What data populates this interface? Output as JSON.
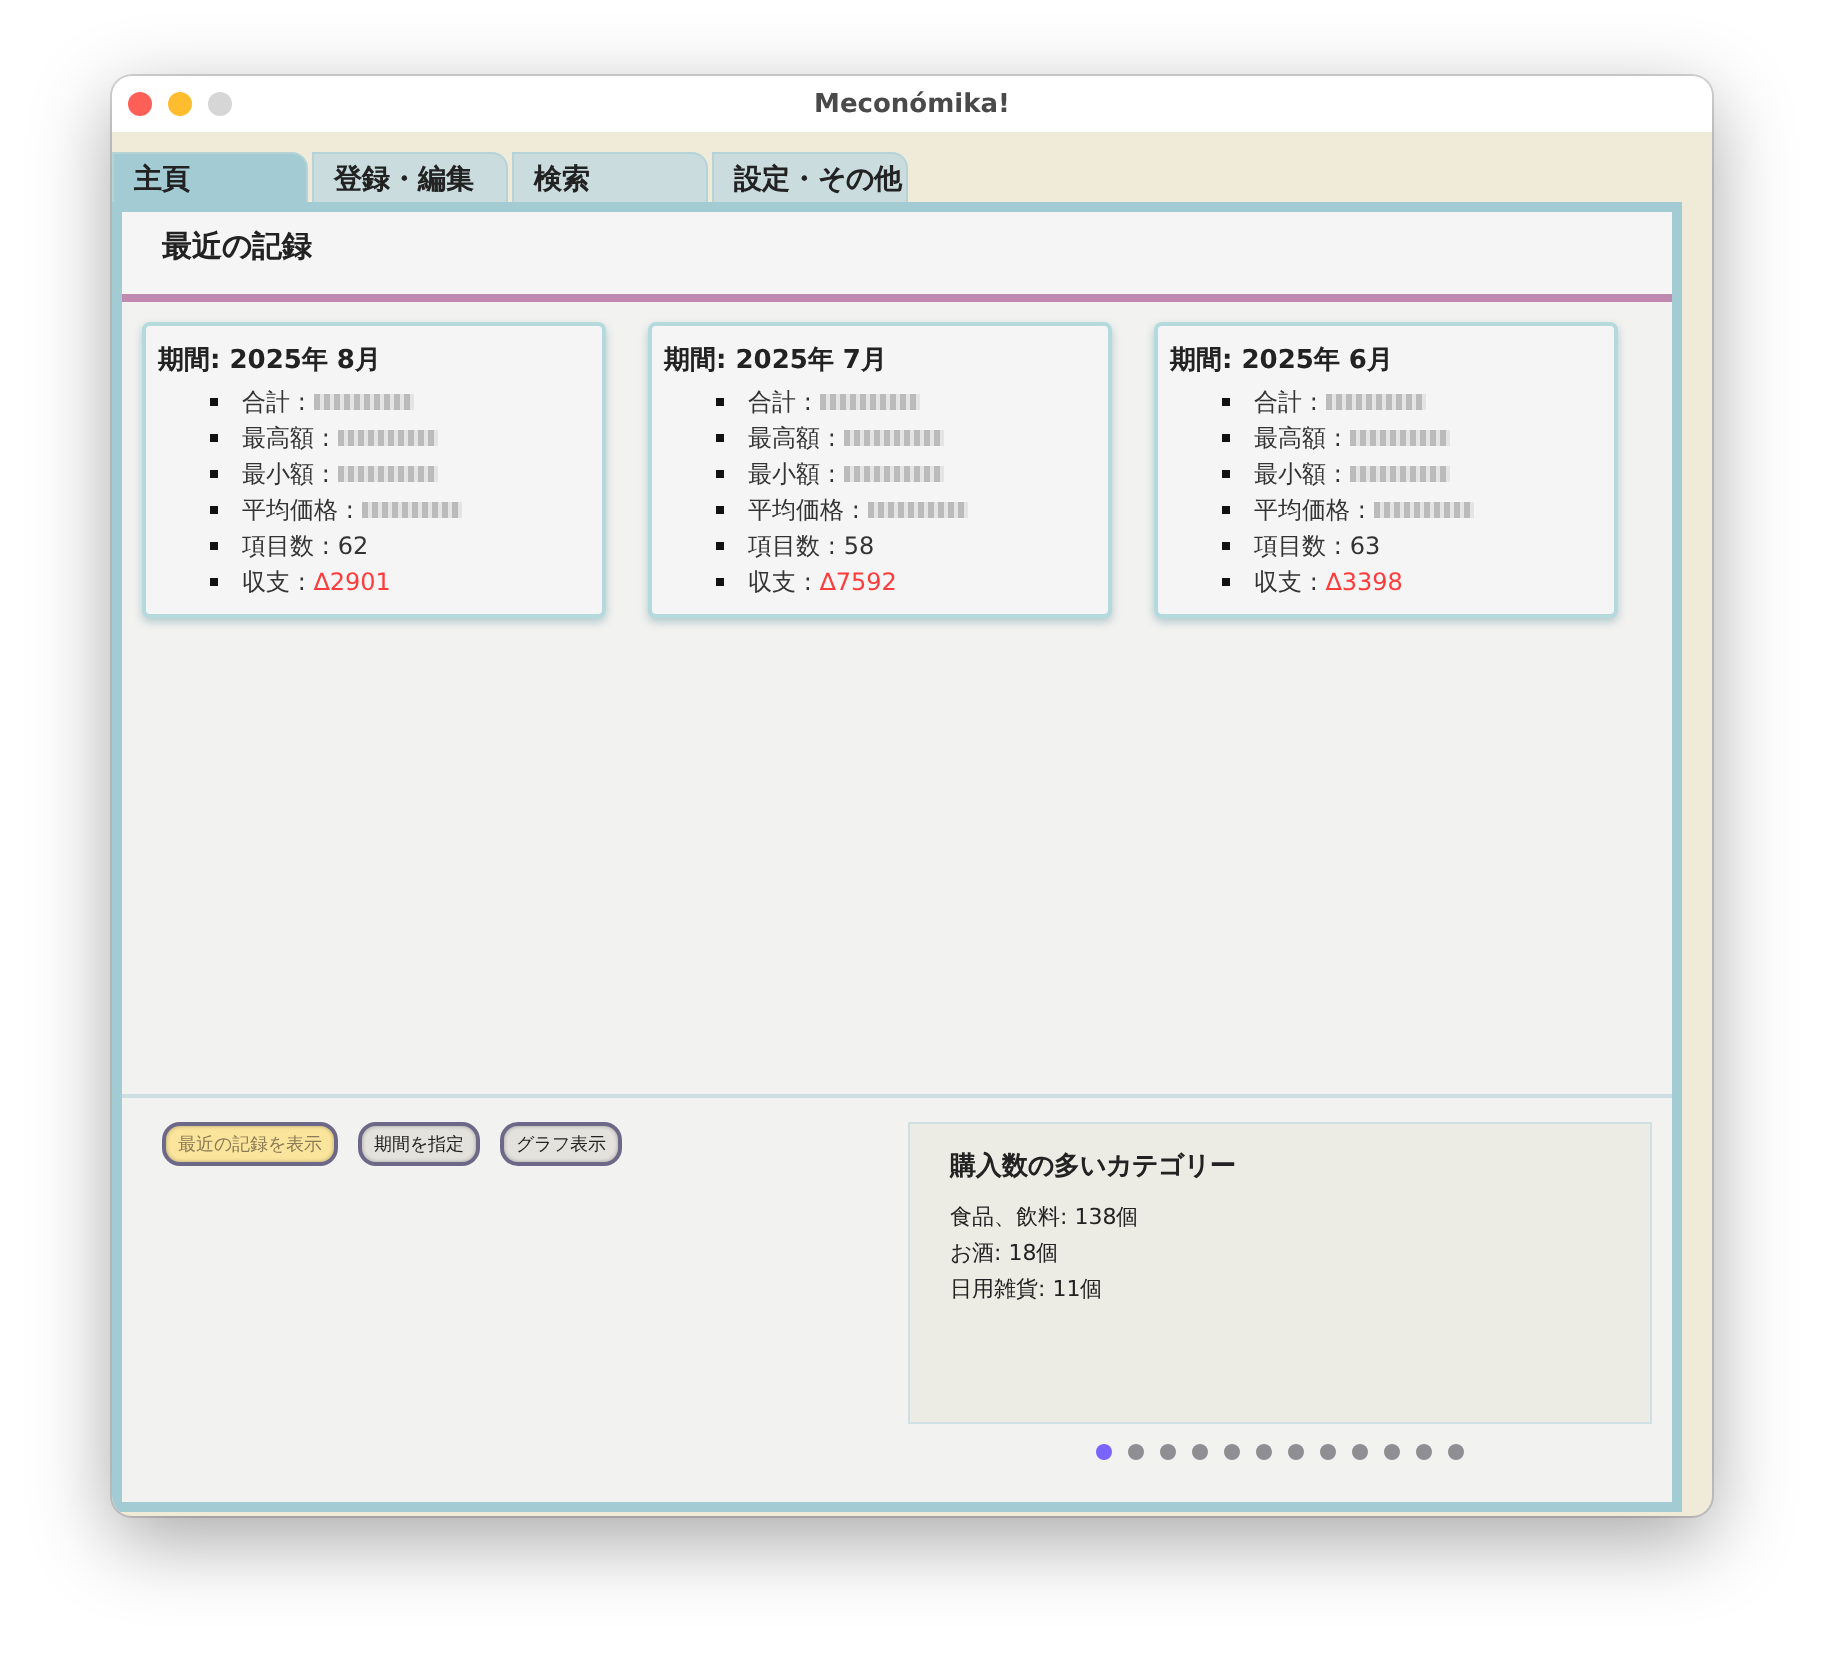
{
  "window": {
    "title": "Meconómika!"
  },
  "tabs": [
    {
      "label": "主頁",
      "selected": true
    },
    {
      "label": "登録・編集",
      "selected": false
    },
    {
      "label": "検索",
      "selected": false
    },
    {
      "label": "設定・その他",
      "selected": false
    }
  ],
  "section_title": "最近の記録",
  "cards": [
    {
      "title": "期間: 2025年 8月",
      "items": [
        {
          "kind": "redacted",
          "label": "合計 :"
        },
        {
          "kind": "redacted",
          "label": "最高額 :"
        },
        {
          "kind": "redacted",
          "label": "最小額 :"
        },
        {
          "kind": "redacted",
          "label": "平均価格 :"
        },
        {
          "kind": "value",
          "label": "項目数 :",
          "value": "62"
        },
        {
          "kind": "balance",
          "label": "収支 :",
          "value": "∆2901"
        }
      ]
    },
    {
      "title": "期間: 2025年 7月",
      "items": [
        {
          "kind": "redacted",
          "label": "合計 :"
        },
        {
          "kind": "redacted",
          "label": "最高額 :"
        },
        {
          "kind": "redacted",
          "label": "最小額 :"
        },
        {
          "kind": "redacted",
          "label": "平均価格 :"
        },
        {
          "kind": "value",
          "label": "項目数 :",
          "value": "58"
        },
        {
          "kind": "balance",
          "label": "収支 :",
          "value": "∆7592"
        }
      ]
    },
    {
      "title": "期間: 2025年 6月",
      "items": [
        {
          "kind": "redacted",
          "label": "合計 :"
        },
        {
          "kind": "redacted",
          "label": "最高額 :"
        },
        {
          "kind": "redacted",
          "label": "最小額 :"
        },
        {
          "kind": "redacted",
          "label": "平均価格 :"
        },
        {
          "kind": "value",
          "label": "項目数 :",
          "value": "63"
        },
        {
          "kind": "balance",
          "label": "収支 :",
          "value": "∆3398"
        }
      ]
    }
  ],
  "buttons": [
    {
      "label": "最近の記録を表示",
      "selected": true
    },
    {
      "label": "期間を指定",
      "selected": false
    },
    {
      "label": "グラフ表示",
      "selected": false
    }
  ],
  "category_panel": {
    "title": "購入数の多いカテゴリー",
    "lines": [
      "食品、飲料: 138個",
      "お酒: 18個",
      "日用雑貨: 11個"
    ]
  },
  "pager_dots": [
    {
      "selected": true
    },
    {
      "selected": false
    },
    {
      "selected": false
    },
    {
      "selected": false
    },
    {
      "selected": false
    },
    {
      "selected": false
    },
    {
      "selected": false
    },
    {
      "selected": false
    },
    {
      "selected": false
    },
    {
      "selected": false
    },
    {
      "selected": false
    },
    {
      "selected": false
    }
  ]
}
